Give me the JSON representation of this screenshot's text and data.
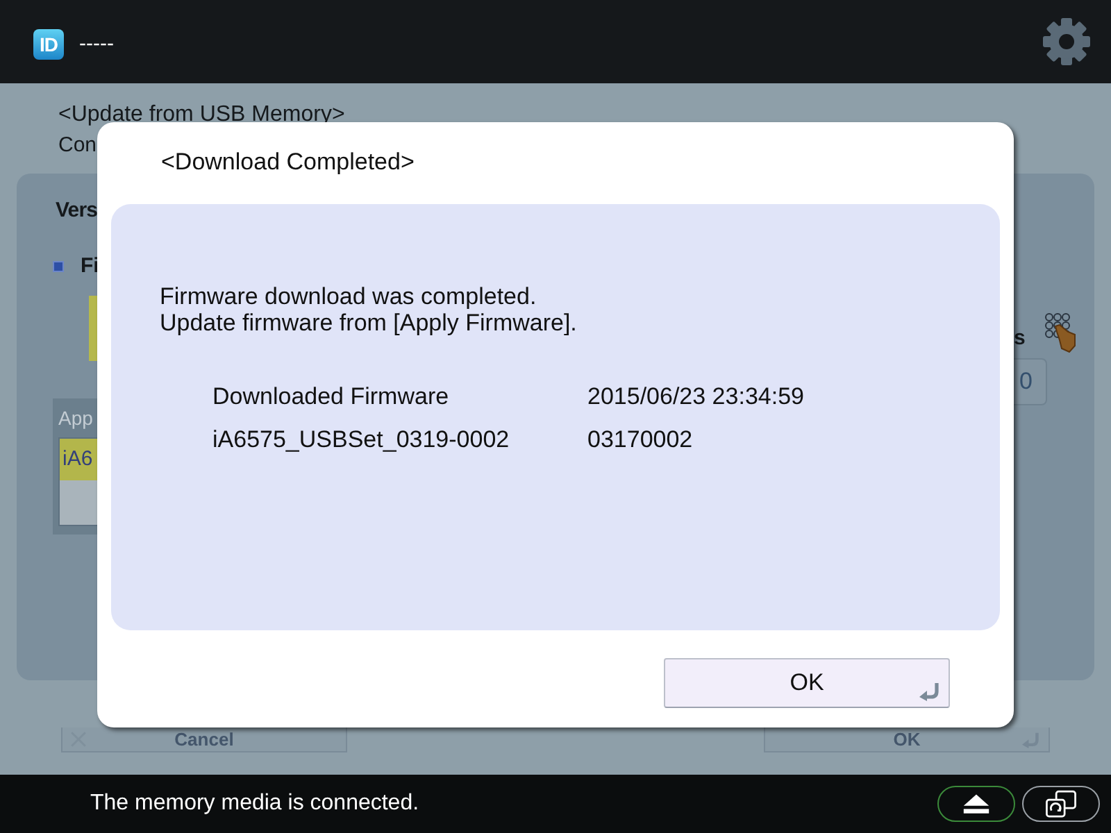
{
  "top_bar": {
    "logo_text": "ID",
    "user_name": "-----"
  },
  "background_screen": {
    "title": "<Update from USB Memory>",
    "subtitle": "Con",
    "panel": {
      "heading": "Vers",
      "bullet_label": "Fi",
      "list": {
        "header": "App",
        "rows": [
          {
            "text": "iA6",
            "selected": true
          }
        ]
      },
      "side_label": "s",
      "field_value": "0"
    },
    "buttons": [
      {
        "label": "Cancel",
        "kind": "cancel"
      },
      {
        "label": "OK",
        "kind": "ok"
      }
    ]
  },
  "dialog": {
    "title": "<Download Completed>",
    "message": [
      "Firmware download was completed.",
      "Update firmware from [Apply Firmware]."
    ],
    "details": [
      {
        "name": "Downloaded Firmware",
        "value": "2015/06/23 23:34:59"
      },
      {
        "name": "iA6575_USBSet_0319-0002",
        "value": "03170002"
      }
    ],
    "button": "OK"
  },
  "status_bar": {
    "message": "The memory media is connected.",
    "buttons": [
      {
        "kind": "eject"
      },
      {
        "kind": "monitor"
      }
    ]
  }
}
